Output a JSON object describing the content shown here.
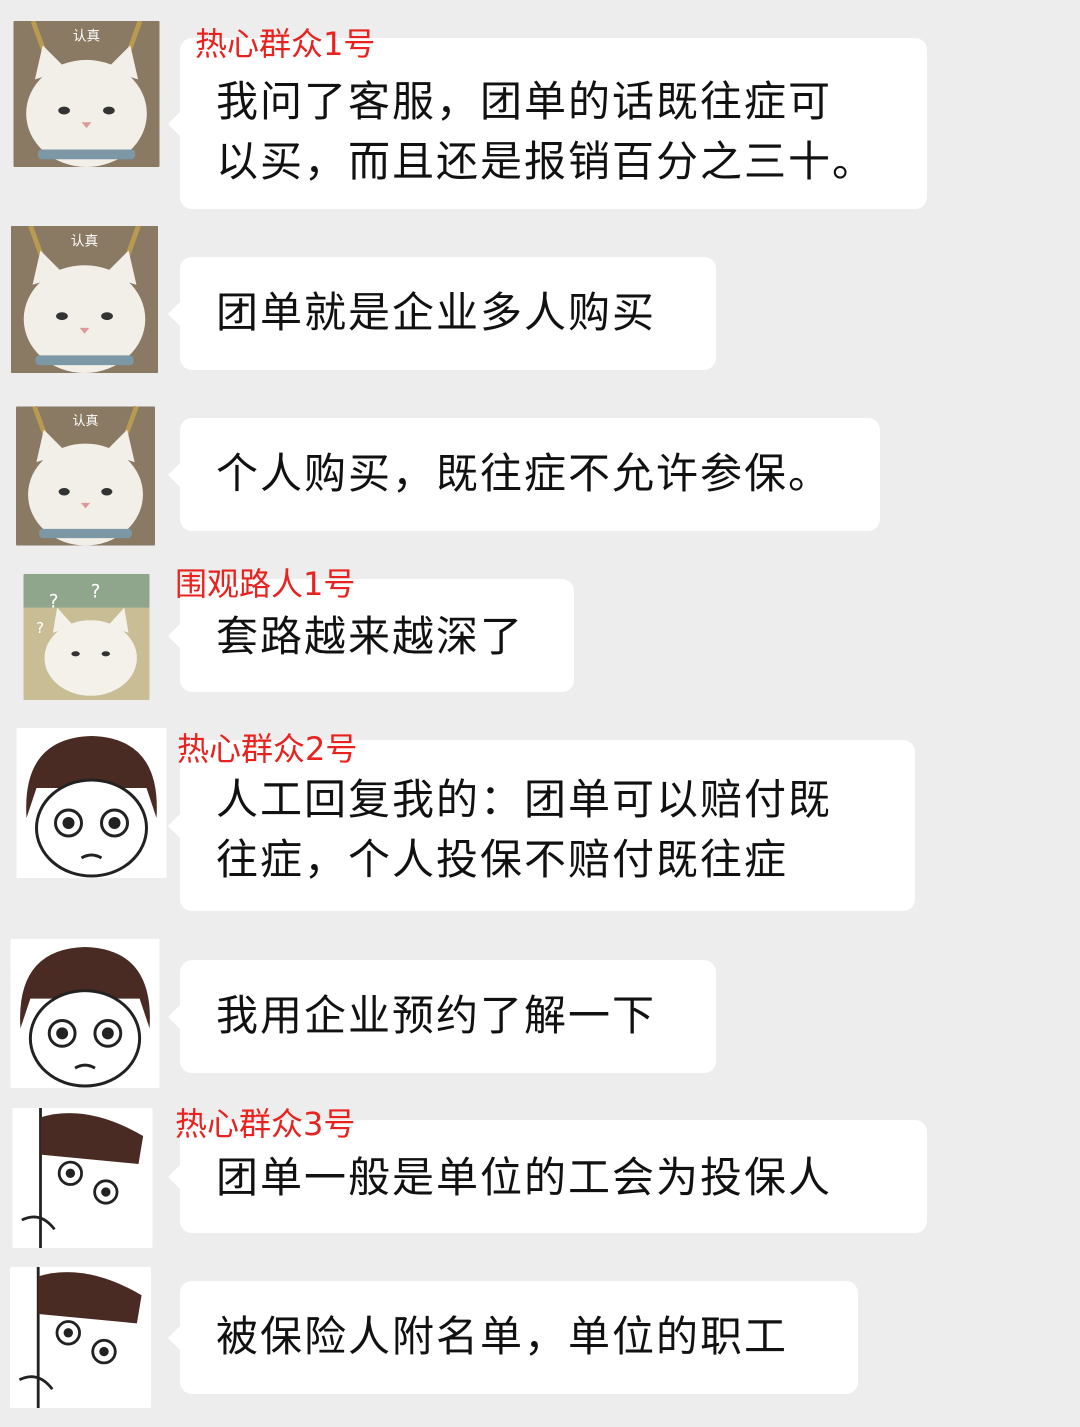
{
  "messages": [
    {
      "sender": "热心群众1号",
      "avatar": "cat-serious-icon",
      "avatar_label": "认真",
      "text": "我问了客服，团单的话既往症可\n以买，而且还是报销百分之三十。"
    },
    {
      "sender": "",
      "avatar": "cat-serious-icon",
      "avatar_label": "认真",
      "text": "团单就是企业多人购买"
    },
    {
      "sender": "",
      "avatar": "cat-serious-icon",
      "avatar_label": "认真",
      "text": "个人购买，既往症不允许参保。"
    },
    {
      "sender": "围观路人1号",
      "avatar": "cat-confused-icon",
      "avatar_label": "",
      "text": "套路越来越深了"
    },
    {
      "sender": "热心群众2号",
      "avatar": "girl-worried-icon",
      "avatar_label": "",
      "text": " 人工回复我的：团单可以赔付既\n往症，个人投保不赔付既往症"
    },
    {
      "sender": "",
      "avatar": "girl-worried-icon",
      "avatar_label": "",
      "text": "我用企业预约了解一下"
    },
    {
      "sender": "热心群众3号",
      "avatar": "girl-peeking-icon",
      "avatar_label": "",
      "text": "  团单一般是单位的工会为投保人"
    },
    {
      "sender": "",
      "avatar": "girl-peeking-icon",
      "avatar_label": "",
      "text": "被保险人附名单，单位的职工"
    }
  ],
  "colors": {
    "background": "#ededed",
    "bubble": "#ffffff",
    "sender_name": "#e8231f",
    "text": "#111111"
  }
}
